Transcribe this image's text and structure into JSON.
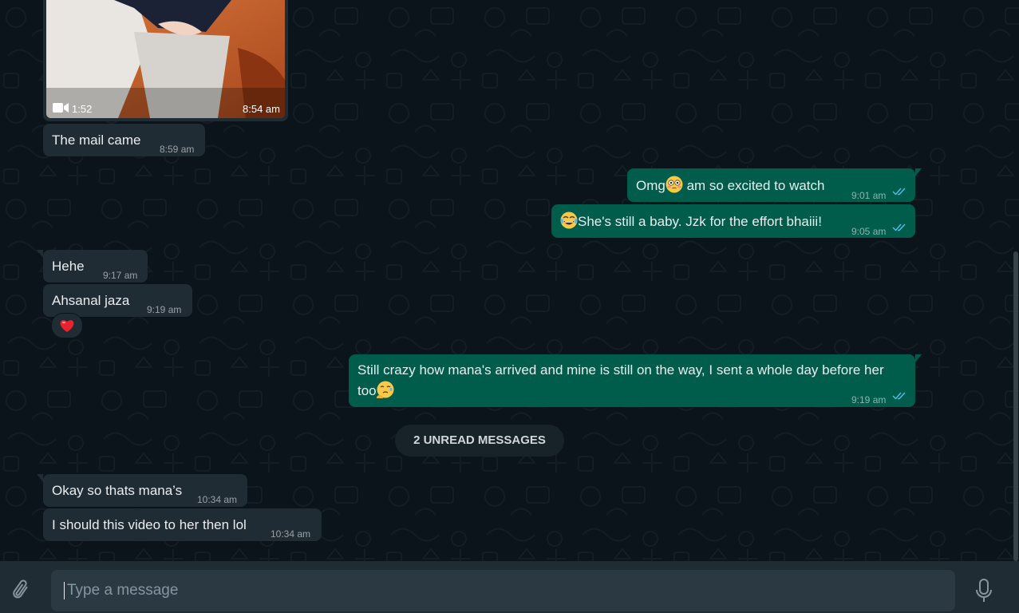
{
  "video_message": {
    "duration": "1:52",
    "time": "8:54 am",
    "video_icon": "video-camera-icon"
  },
  "messages": [
    {
      "dir": "in",
      "text": "The mail came",
      "time": "8:59 am"
    },
    {
      "dir": "out",
      "text_a": "Omg",
      "text_b": " am so excited to watch",
      "emoji": "flushed-face",
      "time": "9:01 am",
      "status": "read"
    },
    {
      "dir": "out",
      "text": "She's still a baby. Jzk for the effort bhaiii!",
      "emoji": "tears-of-joy-face",
      "time": "9:05 am",
      "status": "read"
    },
    {
      "dir": "in",
      "text": "Hehe",
      "time": "9:17 am"
    },
    {
      "dir": "in",
      "text": "Ahsanal jaza",
      "time": "9:19 am",
      "reaction": "red-heart"
    },
    {
      "dir": "out",
      "line1": "Still crazy how mana's arrived and mine is still on the way, I sent a whole day before her",
      "line2": "too",
      "emoji": "face-holding-back-tears",
      "time": "9:19 am",
      "status": "read"
    },
    {
      "dir": "in",
      "text": "Okay so thats mana’s",
      "time": "10:34 am"
    },
    {
      "dir": "in",
      "text": "I should this video to her then lol",
      "time": "10:34 am"
    }
  ],
  "unread_divider": "2 UNREAD MESSAGES",
  "composer": {
    "placeholder": "Type a message",
    "value": ""
  },
  "colors": {
    "bg": "#0b141a",
    "incoming": "#202c33",
    "outgoing": "#005c4b",
    "read_ticks": "#53bdeb",
    "footer": "#202c33",
    "input": "#2a3942"
  }
}
